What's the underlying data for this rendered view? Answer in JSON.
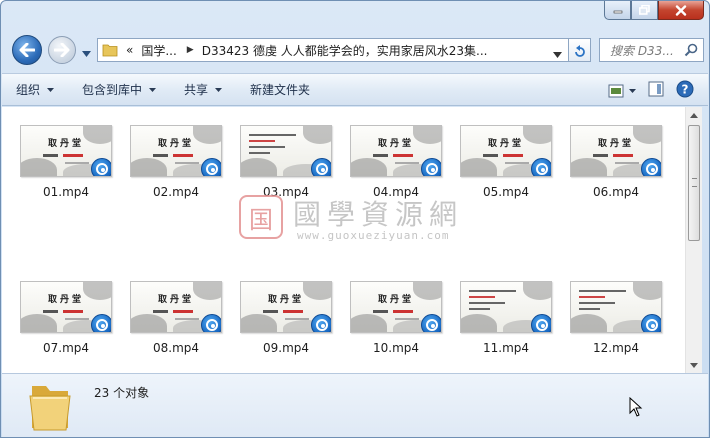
{
  "window": {
    "address": {
      "back_prefix": "«",
      "segment_1": "国学...",
      "segment_2": "D33423 德虔 人人都能学会的，实用家居风水23集..."
    },
    "search": {
      "placeholder": "搜索 D33..."
    }
  },
  "toolbar": {
    "organize": "组织",
    "include_in_library": "包含到库中",
    "share": "共享",
    "new_folder": "新建文件夹"
  },
  "files": [
    {
      "name": "01.mp4",
      "style": "title"
    },
    {
      "name": "02.mp4",
      "style": "title"
    },
    {
      "name": "03.mp4",
      "style": "text"
    },
    {
      "name": "04.mp4",
      "style": "title"
    },
    {
      "name": "05.mp4",
      "style": "title"
    },
    {
      "name": "06.mp4",
      "style": "title"
    },
    {
      "name": "07.mp4",
      "style": "title"
    },
    {
      "name": "08.mp4",
      "style": "title"
    },
    {
      "name": "09.mp4",
      "style": "title"
    },
    {
      "name": "10.mp4",
      "style": "title"
    },
    {
      "name": "11.mp4",
      "style": "text"
    },
    {
      "name": "12.mp4",
      "style": "text"
    }
  ],
  "thumb_title": "取丹堂",
  "watermark": {
    "seal": "国",
    "text": "國學資源網",
    "url": "www.guoxueziyuan.com"
  },
  "details": {
    "count": "23 个对象"
  },
  "colors": {
    "accent": "#2c6bb8",
    "toolbar": "#dfe9f5",
    "video_badge": "#1565c0"
  }
}
